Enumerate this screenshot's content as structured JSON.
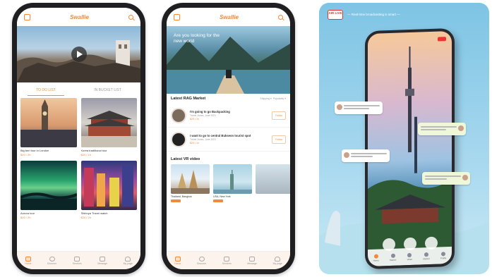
{
  "screen1": {
    "brand": "Swallie",
    "tabs": [
      "TO DO LIST",
      "IN BUCKET LIST"
    ],
    "cards": [
      {
        "title": "Big ben tour in London",
        "price": "$20 / 2h"
      },
      {
        "title": "Korea traditional tour",
        "price": "$20 / 1h"
      },
      {
        "title": "Aurora tour",
        "price": "$20 / 2h"
      },
      {
        "title": "Shibuya Travel watch",
        "price": "$20 / 2h"
      }
    ],
    "nav": [
      "Home",
      "Discover",
      "Services",
      "Message",
      "My page"
    ]
  },
  "screen2": {
    "brand": "Swallie",
    "banner_text": "Are you looking for the new world",
    "market": {
      "title": "Latest RAG Market",
      "filters": [
        "Shipping",
        "Popularity"
      ],
      "items": [
        {
          "title": "I'm going to go Backpacking",
          "sub": "Trevel Jones, June 2021",
          "price": "$20 / 2h",
          "button": "Follow"
        },
        {
          "title": "I want to go to central Bukseon tourist spot",
          "sub": "Trevel Jones, June 2021",
          "price": "$20 / 1h",
          "button": "Follow"
        }
      ]
    },
    "videos": {
      "title": "Latest VR video",
      "items": [
        {
          "title": "Thailand, Bangkok"
        },
        {
          "title": "USA, New York"
        },
        {
          "title": ""
        }
      ]
    },
    "nav": [
      "Home",
      "Discover",
      "Services",
      "Message",
      "My page"
    ]
  },
  "promo": {
    "badge": "AIR LIVE",
    "slogan": "— Real-time broadcasting is smart —",
    "nav": [
      "Home",
      "Search",
      "Video",
      "Market",
      "Profile"
    ]
  }
}
